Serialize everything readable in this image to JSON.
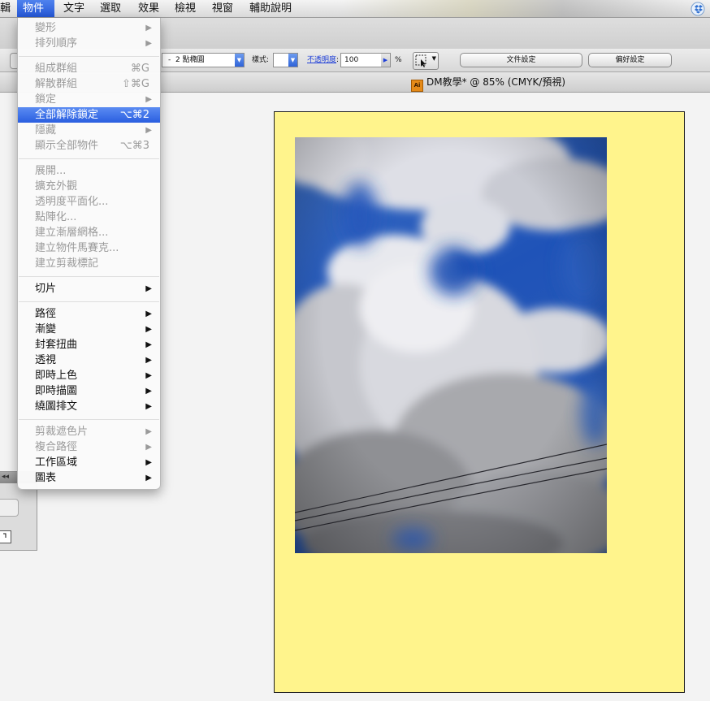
{
  "menubar": {
    "items": [
      {
        "label": "輯"
      },
      {
        "label": "物件"
      },
      {
        "label": "文字"
      },
      {
        "label": "選取"
      },
      {
        "label": "效果"
      },
      {
        "label": "檢視"
      },
      {
        "label": "視窗"
      },
      {
        "label": "輔助說明"
      }
    ],
    "active": "物件"
  },
  "control_bar": {
    "stroke_value": "2 點橢圓",
    "style_label": "樣式:",
    "opacity_label": "不透明度",
    "opacity_colon": ":",
    "opacity_value": "100",
    "percent": "%",
    "doc_setup_button": "文件設定",
    "prefs_button": "偏好設定"
  },
  "document": {
    "title": "DM教學* @ 85% (CMYK/預視)",
    "icon_text": "Ai",
    "artboard_color": "#fff48c"
  },
  "object_menu": {
    "items": [
      {
        "label": "變形",
        "arrow": "▶",
        "disabled": true
      },
      {
        "label": "排列順序",
        "arrow": "▶",
        "disabled": true
      },
      {
        "label": "組成群組",
        "shortcut": "⌘G",
        "disabled": true
      },
      {
        "label": "解散群組",
        "shortcut": "⇧⌘G",
        "disabled": true
      },
      {
        "label": "鎖定",
        "arrow": "▶",
        "disabled": true
      },
      {
        "label": "全部解除鎖定",
        "shortcut": "⌥⌘2",
        "highlight": true
      },
      {
        "label": "隱藏",
        "arrow": "▶",
        "disabled": true
      },
      {
        "label": "顯示全部物件",
        "shortcut": "⌥⌘3",
        "disabled": true
      },
      {
        "label": "展開...",
        "disabled": true
      },
      {
        "label": "擴充外觀",
        "disabled": true
      },
      {
        "label": "透明度平面化...",
        "disabled": true
      },
      {
        "label": "點陣化...",
        "disabled": true
      },
      {
        "label": "建立漸層網格...",
        "disabled": true
      },
      {
        "label": "建立物件馬賽克...",
        "disabled": true
      },
      {
        "label": "建立剪裁標記",
        "disabled": true
      },
      {
        "label": "切片",
        "arrow": "▶"
      },
      {
        "label": "路徑",
        "arrow": "▶"
      },
      {
        "label": "漸變",
        "arrow": "▶"
      },
      {
        "label": "封套扭曲",
        "arrow": "▶"
      },
      {
        "label": "透視",
        "arrow": "▶"
      },
      {
        "label": "即時上色",
        "arrow": "▶"
      },
      {
        "label": "即時描圖",
        "arrow": "▶"
      },
      {
        "label": "繞圖排文",
        "arrow": "▶"
      },
      {
        "label": "剪裁遮色片",
        "arrow": "▶",
        "disabled": true
      },
      {
        "label": "複合路徑",
        "arrow": "▶",
        "disabled": true
      },
      {
        "label": "工作區域",
        "arrow": "▶"
      },
      {
        "label": "圖表",
        "arrow": "▶"
      }
    ]
  }
}
